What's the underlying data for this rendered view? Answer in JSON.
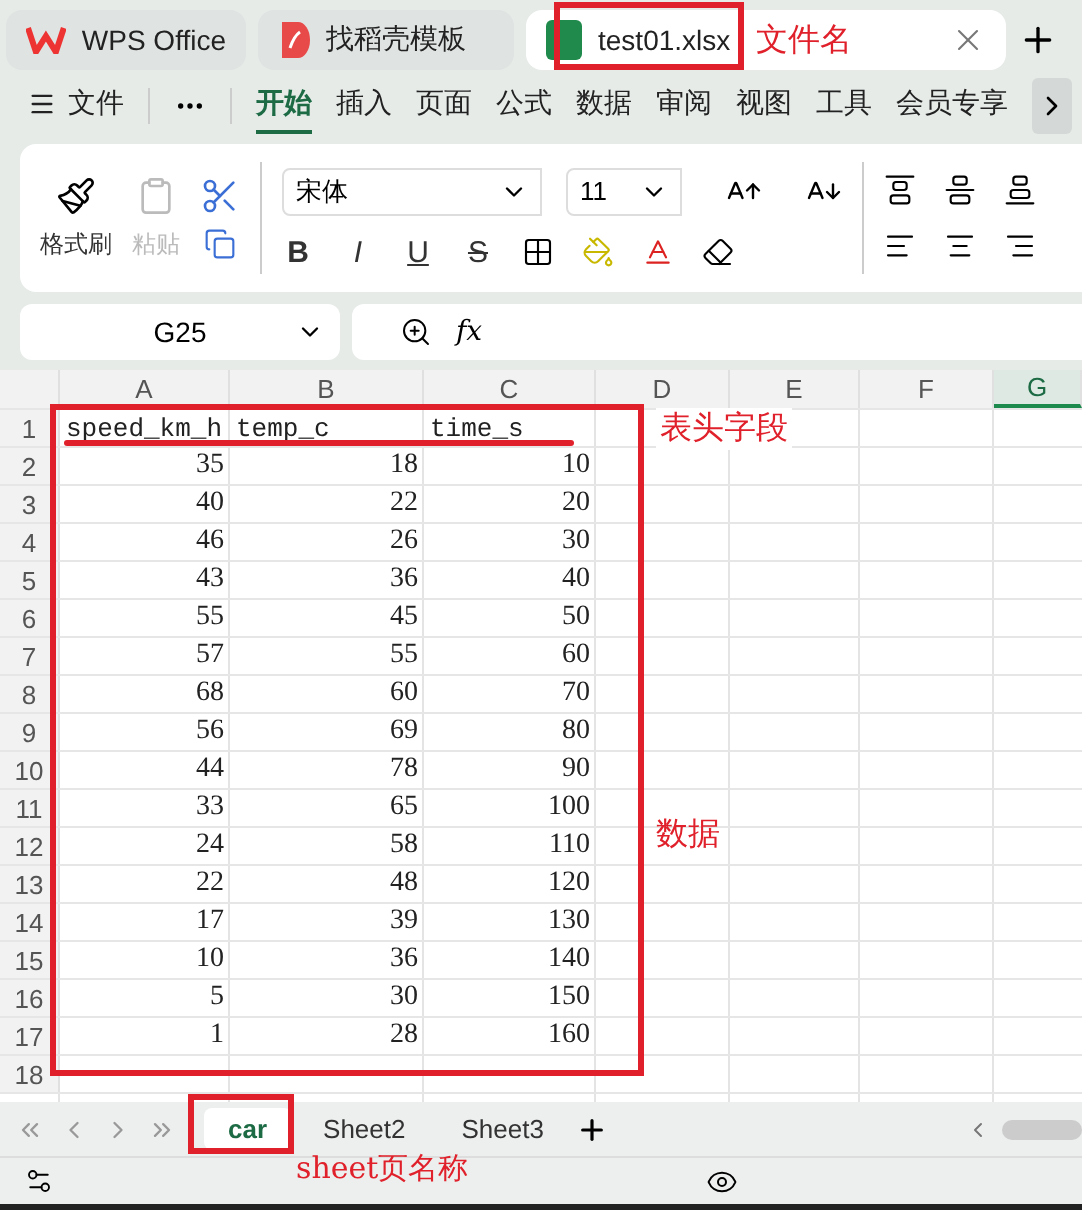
{
  "app_tabs": [
    {
      "kind": "home",
      "label": "WPS Office",
      "selected": false
    },
    {
      "kind": "template",
      "label": "找稻壳模板",
      "selected": false
    },
    {
      "kind": "sheet",
      "label": "test01.xlsx",
      "selected": true
    }
  ],
  "menu": [
    {
      "label": "文件",
      "selected": false
    },
    {
      "label": "开始",
      "selected": true
    },
    {
      "label": "插入",
      "selected": false
    },
    {
      "label": "页面",
      "selected": false
    },
    {
      "label": "公式",
      "selected": false
    },
    {
      "label": "数据",
      "selected": false
    },
    {
      "label": "审阅",
      "selected": false
    },
    {
      "label": "视图",
      "selected": false
    },
    {
      "label": "工具",
      "selected": false
    },
    {
      "label": "会员专享",
      "selected": false
    }
  ],
  "ribbon": {
    "format_painter": "格式刷",
    "paste": {
      "label": "粘贴",
      "disabled": true
    },
    "font": "宋体",
    "font_size": "11",
    "styles": [
      "B",
      "I",
      "U",
      "S"
    ]
  },
  "name_box": "G25",
  "formula_label": "fx",
  "columns": [
    {
      "label": "A",
      "selected": false
    },
    {
      "label": "B",
      "selected": false
    },
    {
      "label": "C",
      "selected": false
    },
    {
      "label": "D",
      "selected": false
    },
    {
      "label": "E",
      "selected": false
    },
    {
      "label": "F",
      "selected": false
    },
    {
      "label": "G",
      "selected": true
    }
  ],
  "rows": [
    {
      "number": "1",
      "kind": "text",
      "cells": [
        "speed_km_h",
        "temp_c",
        "time_s"
      ]
    },
    {
      "number": "2",
      "kind": "number",
      "cells": [
        "35",
        "18",
        "10"
      ]
    },
    {
      "number": "3",
      "kind": "number",
      "cells": [
        "40",
        "22",
        "20"
      ]
    },
    {
      "number": "4",
      "kind": "number",
      "cells": [
        "46",
        "26",
        "30"
      ]
    },
    {
      "number": "5",
      "kind": "number",
      "cells": [
        "43",
        "36",
        "40"
      ]
    },
    {
      "number": "6",
      "kind": "number",
      "cells": [
        "55",
        "45",
        "50"
      ]
    },
    {
      "number": "7",
      "kind": "number",
      "cells": [
        "57",
        "55",
        "60"
      ]
    },
    {
      "number": "8",
      "kind": "number",
      "cells": [
        "68",
        "60",
        "70"
      ]
    },
    {
      "number": "9",
      "kind": "number",
      "cells": [
        "56",
        "69",
        "80"
      ]
    },
    {
      "number": "10",
      "kind": "number",
      "cells": [
        "44",
        "78",
        "90"
      ]
    },
    {
      "number": "11",
      "kind": "number",
      "cells": [
        "33",
        "65",
        "100"
      ]
    },
    {
      "number": "12",
      "kind": "number",
      "cells": [
        "24",
        "58",
        "110"
      ]
    },
    {
      "number": "13",
      "kind": "number",
      "cells": [
        "22",
        "48",
        "120"
      ]
    },
    {
      "number": "14",
      "kind": "number",
      "cells": [
        "17",
        "39",
        "130"
      ]
    },
    {
      "number": "15",
      "kind": "number",
      "cells": [
        "10",
        "36",
        "140"
      ]
    },
    {
      "number": "16",
      "kind": "number",
      "cells": [
        "5",
        "30",
        "150"
      ]
    },
    {
      "number": "17",
      "kind": "number",
      "cells": [
        "1",
        "28",
        "160"
      ]
    },
    {
      "number": "18",
      "kind": "empty",
      "cells": []
    }
  ],
  "sheets": [
    {
      "label": "car",
      "selected": true
    },
    {
      "label": "Sheet2",
      "selected": false
    },
    {
      "label": "Sheet3",
      "selected": false
    }
  ],
  "annotations": {
    "file_name": "文件名",
    "header_fields": "表头字段",
    "data": "数据",
    "sheet_name": "sheet页名称"
  }
}
